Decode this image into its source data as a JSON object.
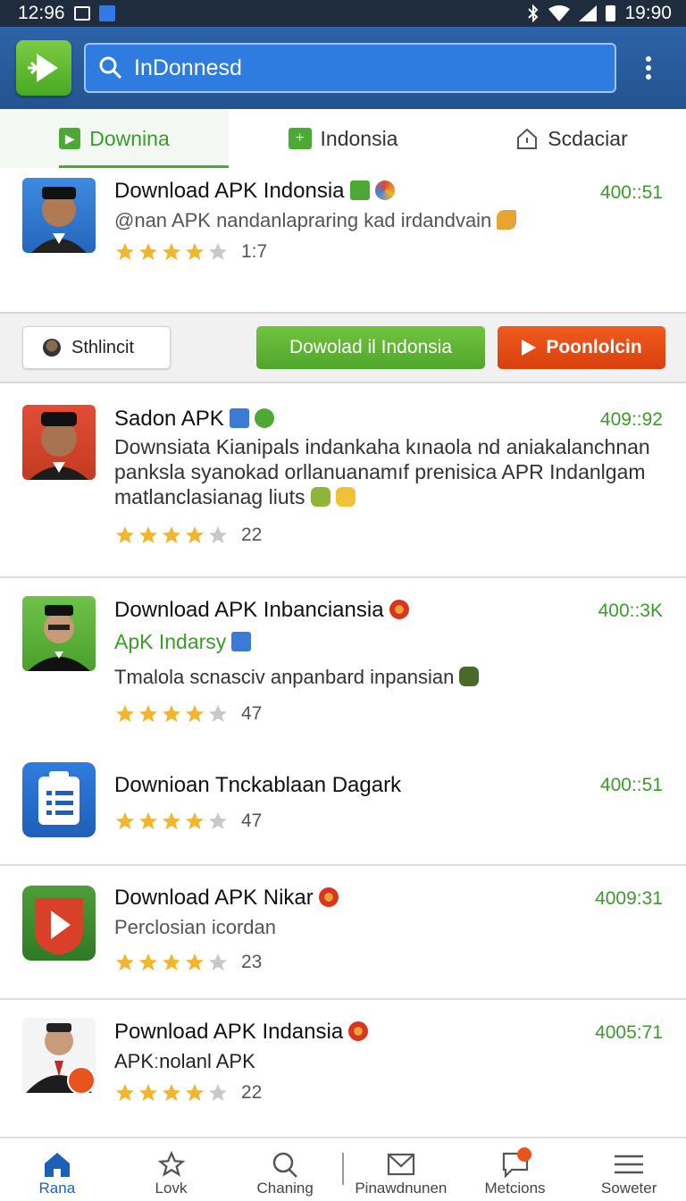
{
  "status_bar": {
    "time_left": "12:96",
    "time_right": "19:90"
  },
  "app_bar": {
    "search_value": "InDonnesd"
  },
  "tabs": [
    {
      "label": "Downina",
      "active": true
    },
    {
      "label": "Indonsia"
    },
    {
      "label": "Scdaciar"
    }
  ],
  "apps": [
    {
      "title": "Download APK Indonsia",
      "time": "400::51",
      "desc": "@nan APK nandanlapraring kad irdandvain",
      "rating": 4,
      "count": "1:7"
    },
    {
      "title": "Sadon APK",
      "time": "409::92",
      "desc_lines": [
        "Downsiata Kianipals indankaha kınaola nd aniakalanchnan",
        "panksla syanokad orllanuanamıf prenisica APR Indanlgam",
        "matlanclasianag liuts"
      ],
      "rating": 4,
      "count": "22"
    },
    {
      "title": "Download APK Inbanciansia",
      "time": "400::3K",
      "sub": "ApK Indarsy",
      "desc": "Tmalola scnasciv anpanbard inpansian",
      "rating": 4,
      "count": "47"
    },
    {
      "title": "Downioan Tnckablaan Dagark",
      "time": "400::51",
      "rating": 4,
      "count": "47"
    },
    {
      "title": "Download APK Nikar",
      "time": "4009:31",
      "desc": "Perclosian icordan",
      "rating": 4,
      "count": "23"
    },
    {
      "title": "Pownload APK Indansia",
      "time": "4005:71",
      "desc": "APKːnolanl APK",
      "rating": 4,
      "count": "22"
    }
  ],
  "actions": {
    "share_label": "Sthlincit",
    "download_label": "Dowolad il Indonsia",
    "play_label": "Poonlolcin"
  },
  "bottom_nav": [
    {
      "label": "Rana",
      "icon": "home-icon",
      "active": true
    },
    {
      "label": "Lovk",
      "icon": "star-icon"
    },
    {
      "label": "Chaning",
      "icon": "search-icon"
    },
    {
      "label": "Pinawdnunen",
      "icon": "mail-icon"
    },
    {
      "label": "Metcions",
      "icon": "chat-icon"
    },
    {
      "label": "Soweter",
      "icon": "menu-icon"
    }
  ],
  "colors": {
    "primary_blue": "#24548f",
    "accent_green": "#4caa34",
    "accent_orange": "#e0470f",
    "star": "#f2b530"
  }
}
